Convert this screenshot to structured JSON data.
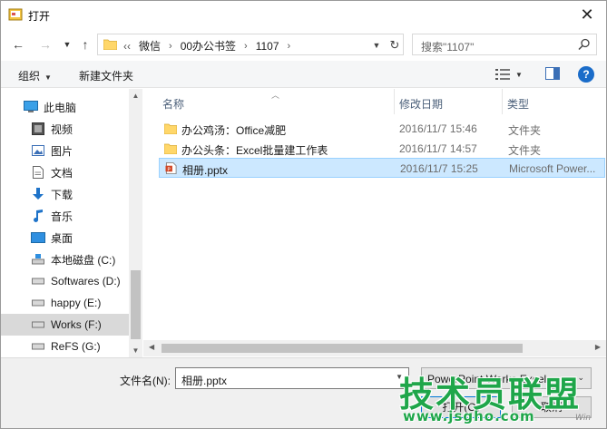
{
  "window": {
    "title": "打开"
  },
  "colors": {
    "accent": "#0078d7",
    "selection": "#cce8ff",
    "watermark": "#1fa64a"
  },
  "address": {
    "lead": "‹‹",
    "crumbs": [
      "微信",
      "00办公书签",
      "1107"
    ]
  },
  "search": {
    "placeholder": "搜索\"1107\""
  },
  "toolbar": {
    "organize_label": "组织",
    "new_folder_label": "新建文件夹",
    "help_label": "?"
  },
  "nav": {
    "items": [
      {
        "label": "此电脑",
        "icon": "computer-icon"
      },
      {
        "label": "视频",
        "icon": "video-icon"
      },
      {
        "label": "图片",
        "icon": "pictures-icon"
      },
      {
        "label": "文档",
        "icon": "documents-icon"
      },
      {
        "label": "下载",
        "icon": "download-icon"
      },
      {
        "label": "音乐",
        "icon": "music-icon"
      },
      {
        "label": "桌面",
        "icon": "desktop-icon"
      },
      {
        "label": "本地磁盘 (C:)",
        "icon": "drive-icon"
      },
      {
        "label": "Softwares (D:)",
        "icon": "drive-icon"
      },
      {
        "label": "happy (E:)",
        "icon": "drive-icon"
      },
      {
        "label": "Works (F:)",
        "icon": "drive-icon"
      },
      {
        "label": "ReFS (G:)",
        "icon": "drive-icon"
      }
    ],
    "selected_index": 10
  },
  "columns": {
    "name": "名称",
    "date": "修改日期",
    "type": "类型"
  },
  "files": [
    {
      "name": "办公鸡汤：Office减肥",
      "date": "2016/11/7 15:46",
      "type": "文件夹",
      "icon": "folder-icon"
    },
    {
      "name": "办公头条：Excel批量建工作表",
      "date": "2016/11/7 14:57",
      "type": "文件夹",
      "icon": "folder-icon"
    },
    {
      "name": "相册.pptx",
      "date": "2016/11/7 15:25",
      "type": "Microsoft Power...",
      "icon": "pptx-file-icon"
    }
  ],
  "selected_file_index": 2,
  "footer": {
    "filename_label": "文件名(N):",
    "filename_value": "相册.pptx",
    "filetype_value": "PowerPoint Works Excel",
    "open_label": "打开(O)",
    "cancel_label": "取消"
  },
  "watermark": {
    "main": "技术员联盟",
    "sub": "www.jsgho.com",
    "tag": "Win"
  }
}
